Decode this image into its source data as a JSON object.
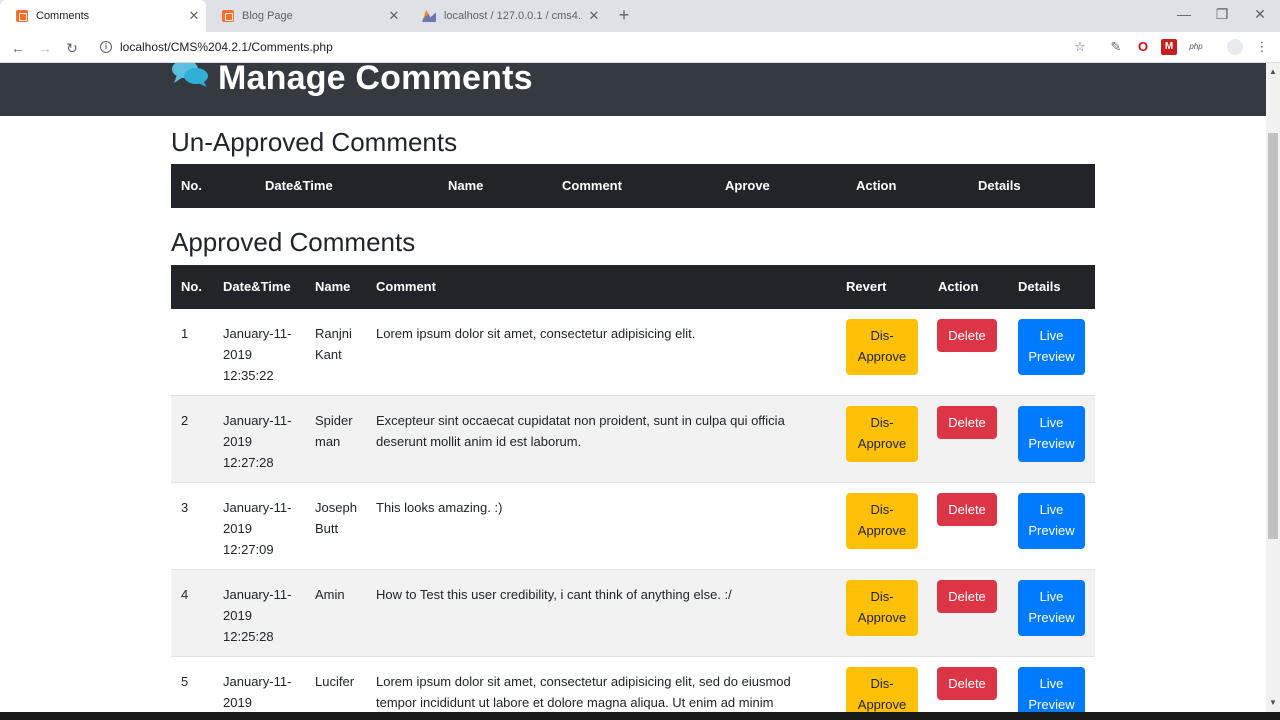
{
  "browser": {
    "tabs": [
      {
        "title": "Comments",
        "active": true
      },
      {
        "title": "Blog Page",
        "active": false
      },
      {
        "title": "localhost / 127.0.0.1 / cms4.2.1 /",
        "active": false
      }
    ],
    "url": "localhost/CMS%204.2.1/Comments.php"
  },
  "header": {
    "title": "Manage Comments"
  },
  "unapproved": {
    "title": "Un-Approved Comments",
    "columns": [
      "No.",
      "Date&Time",
      "Name",
      "Comment",
      "Aprove",
      "Action",
      "Details"
    ]
  },
  "approved": {
    "title": "Approved Comments",
    "columns": [
      "No.",
      "Date&Time",
      "Name",
      "Comment",
      "Revert",
      "Action",
      "Details"
    ],
    "rows": [
      {
        "no": "1",
        "date": "January-11-",
        "year": "2019",
        "time": "12:35:22",
        "name1": "Ranjni",
        "name2": "Kant",
        "comment1": "Lorem ipsum dolor sit amet, consectetur adipisicing elit.",
        "comment2": ""
      },
      {
        "no": "2",
        "date": "January-11-",
        "year": "2019",
        "time": "12:27:28",
        "name1": "Spider",
        "name2": "man",
        "comment1": "Excepteur sint occaecat cupidatat non proident, sunt in culpa qui officia",
        "comment2": "deserunt mollit anim id est laborum."
      },
      {
        "no": "3",
        "date": "January-11-",
        "year": "2019",
        "time": "12:27:09",
        "name1": "Joseph",
        "name2": "Butt",
        "comment1": "This looks amazing. :)",
        "comment2": ""
      },
      {
        "no": "4",
        "date": "January-11-",
        "year": "2019",
        "time": "12:25:28",
        "name1": "Amin",
        "name2": "",
        "comment1": "How to Test this user credibility, i cant think of anything else. :/",
        "comment2": ""
      },
      {
        "no": "5",
        "date": "January-11-",
        "year": "2019",
        "time": "",
        "name1": "Lucifer",
        "name2": "",
        "comment1": "Lorem ipsum dolor sit amet, consectetur adipisicing elit, sed do eiusmod",
        "comment2": "tempor incididunt ut labore et dolore magna aliqua. Ut enim ad minim"
      }
    ],
    "buttons": {
      "disapprove1": "Dis-",
      "disapprove2": "Approve",
      "delete": "Delete",
      "preview1": "Live",
      "preview2": "Preview"
    }
  },
  "colors": {
    "header_bg": "#343a40",
    "table_head": "#212529",
    "warning": "#ffc107",
    "danger": "#dc3545",
    "primary": "#007bff"
  }
}
